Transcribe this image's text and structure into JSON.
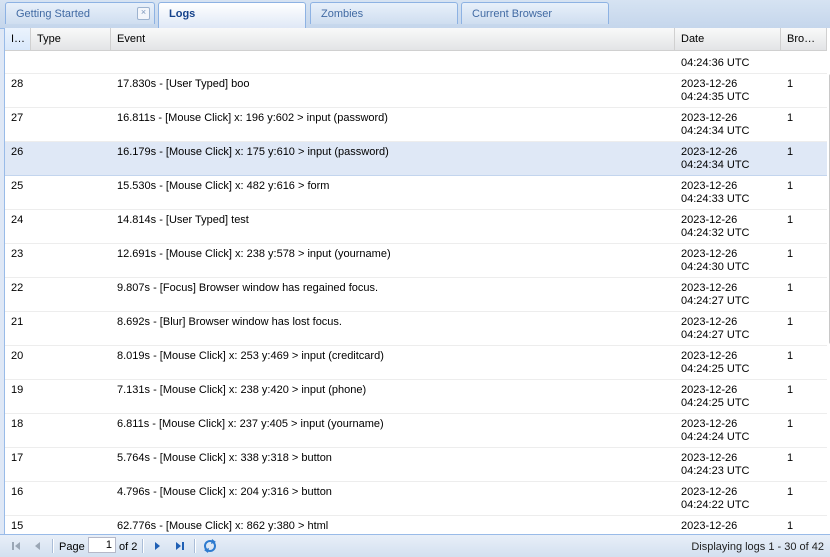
{
  "tabs": [
    {
      "label": "Getting Started",
      "closable": true
    },
    {
      "label": "Logs",
      "active": true
    },
    {
      "label": "Zombies"
    },
    {
      "label": "Current Browser"
    }
  ],
  "columns": {
    "id": "I…",
    "type": "Type",
    "event": "Event",
    "date": "Date",
    "browser": "Bro…"
  },
  "rows": [
    {
      "id": "",
      "type": "",
      "event": "",
      "date1": "",
      "date2": "04:24:36 UTC",
      "browser": ""
    },
    {
      "id": "28",
      "type": "",
      "event": "17.830s - [User Typed] boo",
      "date1": "2023-12-26",
      "date2": "04:24:35 UTC",
      "browser": "1"
    },
    {
      "id": "27",
      "type": "",
      "event": "16.811s - [Mouse Click] x: 196 y:602 > input (password)",
      "date1": "2023-12-26",
      "date2": "04:24:34 UTC",
      "browser": "1"
    },
    {
      "id": "26",
      "type": "",
      "event": "16.179s - [Mouse Click] x: 175 y:610 > input (password)",
      "date1": "2023-12-26",
      "date2": "04:24:34 UTC",
      "browser": "1",
      "selected": true
    },
    {
      "id": "25",
      "type": "",
      "event": "15.530s - [Mouse Click] x: 482 y:616 > form",
      "date1": "2023-12-26",
      "date2": "04:24:33 UTC",
      "browser": "1"
    },
    {
      "id": "24",
      "type": "",
      "event": "14.814s - [User Typed] test",
      "date1": "2023-12-26",
      "date2": "04:24:32 UTC",
      "browser": "1"
    },
    {
      "id": "23",
      "type": "",
      "event": "12.691s - [Mouse Click] x: 238 y:578 > input (yourname)",
      "date1": "2023-12-26",
      "date2": "04:24:30 UTC",
      "browser": "1"
    },
    {
      "id": "22",
      "type": "",
      "event": "9.807s - [Focus] Browser window has regained focus.",
      "date1": "2023-12-26",
      "date2": "04:24:27 UTC",
      "browser": "1"
    },
    {
      "id": "21",
      "type": "",
      "event": "8.692s - [Blur] Browser window has lost focus.",
      "date1": "2023-12-26",
      "date2": "04:24:27 UTC",
      "browser": "1"
    },
    {
      "id": "20",
      "type": "",
      "event": "8.019s - [Mouse Click] x: 253 y:469 > input (creditcard)",
      "date1": "2023-12-26",
      "date2": "04:24:25 UTC",
      "browser": "1"
    },
    {
      "id": "19",
      "type": "",
      "event": "7.131s - [Mouse Click] x: 238 y:420 > input (phone)",
      "date1": "2023-12-26",
      "date2": "04:24:25 UTC",
      "browser": "1"
    },
    {
      "id": "18",
      "type": "",
      "event": "6.811s - [Mouse Click] x: 237 y:405 > input (yourname)",
      "date1": "2023-12-26",
      "date2": "04:24:24 UTC",
      "browser": "1"
    },
    {
      "id": "17",
      "type": "",
      "event": "5.764s - [Mouse Click] x: 338 y:318 > button",
      "date1": "2023-12-26",
      "date2": "04:24:23 UTC",
      "browser": "1"
    },
    {
      "id": "16",
      "type": "",
      "event": "4.796s - [Mouse Click] x: 204 y:316 > button",
      "date1": "2023-12-26",
      "date2": "04:24:22 UTC",
      "browser": "1"
    },
    {
      "id": "15",
      "type": "",
      "event": "62.776s - [Mouse Click] x: 862 y:380 > html",
      "date1": "2023-12-26",
      "date2": "",
      "browser": "1"
    }
  ],
  "pager": {
    "page_label": "Page",
    "page_value": "1",
    "of_label": "of 2",
    "display_msg": "Displaying logs 1 - 30 of 42",
    "icons": [
      "first-page-icon",
      "prev-page-icon",
      "next-page-icon",
      "last-page-icon",
      "refresh-icon"
    ]
  }
}
